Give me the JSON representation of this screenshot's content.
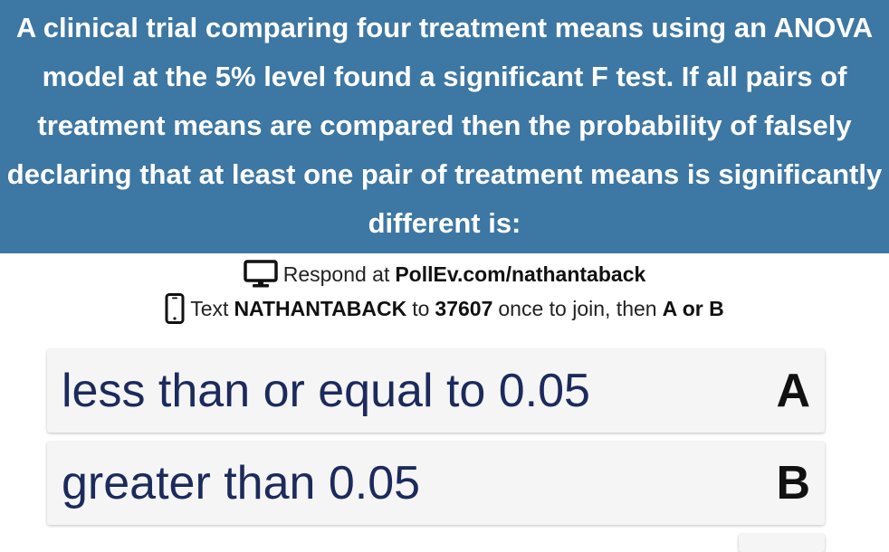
{
  "question": {
    "text": "A clinical trial comparing four treatment means using an ANOVA model at the 5% level found a significant F test. If all pairs of treatment means are compared then the probability of falsely declaring that at least one pair of treatment means is significantly different is:"
  },
  "instructions": {
    "web": {
      "icon": "monitor-icon",
      "prefix": "Respond at",
      "url": "PollEv.com/nathantaback"
    },
    "sms": {
      "icon": "phone-icon",
      "prefix": "Text",
      "keyword": "NATHANTABACK",
      "to_label": "to",
      "number": "37607",
      "suffix": "once to join, then",
      "choices": "A or B"
    }
  },
  "options": [
    {
      "text": "less than or equal to 0.05",
      "key": "A"
    },
    {
      "text": "greater than 0.05",
      "key": "B"
    }
  ],
  "colors": {
    "header_bg": "#3d77a3",
    "option_text": "#1c2a5c",
    "option_bg": "#f5f5f5"
  }
}
